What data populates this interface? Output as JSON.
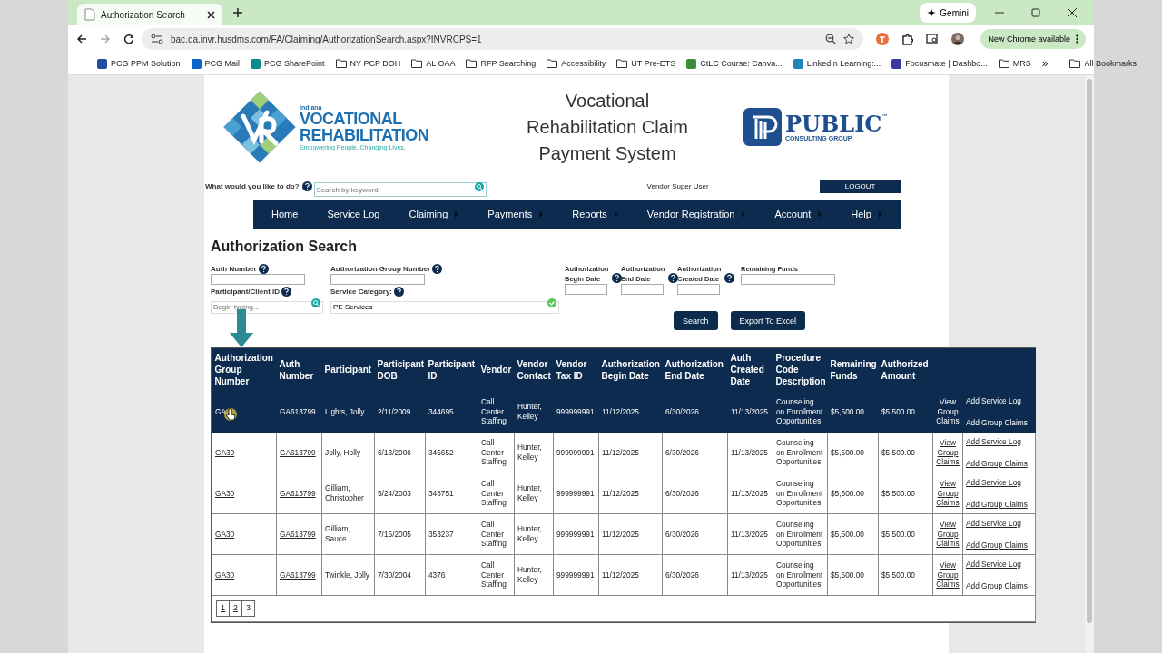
{
  "browser": {
    "tab": {
      "title": "Authorization Search"
    },
    "gemini": "Gemini",
    "url": "bac.qa.invr.husdms.com/FA/Claiming/AuthorizationSearch.aspx?INVRCPS=1",
    "update": "New Chrome available",
    "bookmarks": [
      {
        "label": "PCG PPM Solution",
        "kind": "site",
        "color": "#1f4e9c"
      },
      {
        "label": "PCG Mail",
        "kind": "site",
        "color": "#0a64c8"
      },
      {
        "label": "PCG SharePoint",
        "kind": "site",
        "color": "#0f8a8a"
      },
      {
        "label": "NY PCP DOH",
        "kind": "folder"
      },
      {
        "label": "AL OAA",
        "kind": "folder"
      },
      {
        "label": "RFP Searching",
        "kind": "folder"
      },
      {
        "label": "Accessibility",
        "kind": "folder"
      },
      {
        "label": "UT Pre-ETS",
        "kind": "folder"
      },
      {
        "label": "CtLC Course: Canva...",
        "kind": "site",
        "color": "#3d8c3a"
      },
      {
        "label": "LinkedIn Learning:...",
        "kind": "site",
        "color": "#1b86b8"
      },
      {
        "label": "Focusmate | Dashbo...",
        "kind": "site",
        "color": "#3c3ca0"
      },
      {
        "label": "MRS",
        "kind": "folder"
      }
    ],
    "more": "»",
    "all_bookmarks": "All Bookmarks"
  },
  "header": {
    "logo": {
      "state": "Indiana",
      "line1": "VOCATIONAL",
      "line2": "REHABILITATION",
      "tagline": "Empowering People. Changing Lives."
    },
    "title_lines": [
      "Vocational",
      "Rehabilitation Claim",
      "Payment System"
    ],
    "pcg": {
      "name": "PUBLIC",
      "tm": "™",
      "sub": "CONSULTING GROUP"
    }
  },
  "search": {
    "label": "What would you like to do?",
    "placeholder": "Search by keyword"
  },
  "user": "Vendor Super User",
  "logout": "LOGOUT",
  "nav": [
    {
      "label": "Home",
      "submenu": false
    },
    {
      "label": "Service Log",
      "submenu": false
    },
    {
      "label": "Claiming",
      "submenu": true
    },
    {
      "label": "Payments",
      "submenu": true
    },
    {
      "label": "Reports",
      "submenu": true
    },
    {
      "label": "Vendor Registration",
      "submenu": true
    },
    {
      "label": "Account",
      "submenu": true
    },
    {
      "label": "Help",
      "submenu": true
    }
  ],
  "heading": "Authorization Search",
  "left_fields": [
    {
      "label": "Auth Number",
      "help": true,
      "kind": "text"
    },
    {
      "label": "Authorization Group Number",
      "help": true,
      "kind": "text"
    },
    {
      "label": "Participant/Client ID",
      "help": true,
      "kind": "lookup",
      "placeholder": "Begin typing..."
    },
    {
      "label": "Service Category:",
      "help": true,
      "kind": "select",
      "value": "PE Services"
    }
  ],
  "date_fields": [
    {
      "label": "Authorization Begin Date",
      "help": true
    },
    {
      "label": "Authorization End Date",
      "help": true
    },
    {
      "label": "Authorization Created Date",
      "help": true
    },
    {
      "label": "Remaining Funds",
      "help": false
    }
  ],
  "buttons": [
    "Search",
    "Export To Excel"
  ],
  "table": {
    "columns": [
      "Authorization Group Number",
      "Auth Number",
      "Participant",
      "Participant DOB",
      "Participant ID",
      "Vendor",
      "Vendor Contact",
      "Vendor Tax ID",
      "Authorization Begin Date",
      "Authorization End Date",
      "Auth Created Date",
      "Procedure Code Description",
      "Remaining Funds",
      "Authorized Amount"
    ],
    "rows": [
      {
        "selected": true,
        "cells": [
          "GA",
          "GA613799",
          "Lights, Jolly",
          "2/11/2009",
          "344695",
          "Call Center Staffing",
          "Hunter, Kelley",
          "999999991",
          "11/12/2025",
          "6/30/2026",
          "11/13/2025",
          "Counseling on Enrollment Opportunities",
          "$5,500.00",
          "$5,500.00"
        ],
        "view": "View Group Claims",
        "service_log": "Add Service Log",
        "group_claims": "Add Group Claims"
      },
      {
        "selected": false,
        "cells": [
          "GA30",
          "GA613799",
          "Jolly, Holly",
          "6/13/2006",
          "345652",
          "Call Center Staffing",
          "Hunter, Kelley",
          "999999991",
          "11/12/2025",
          "6/30/2026",
          "11/13/2025",
          "Counseling on Enrollment Opportunities",
          "$5,500.00",
          "$5,500.00"
        ],
        "view": "View Group Claims",
        "service_log": "Add Service Log",
        "group_claims": "Add Group Claims"
      },
      {
        "selected": false,
        "cells": [
          "GA30",
          "GA613799",
          "Gilliam, Christopher",
          "5/24/2003",
          "348751",
          "Call Center Staffing",
          "Hunter, Kelley",
          "999999991",
          "11/12/2025",
          "6/30/2026",
          "11/13/2025",
          "Counseling on Enrollment Opportunities",
          "$5,500.00",
          "$5,500.00"
        ],
        "view": "View Group Claims",
        "service_log": "Add Service Log",
        "group_claims": "Add Group Claims"
      },
      {
        "selected": false,
        "cells": [
          "GA30",
          "GA613799",
          "Gilliam, Sauce",
          "7/15/2005",
          "353237",
          "Call Center Staffing",
          "Hunter, Kelley",
          "999999991",
          "11/12/2025",
          "6/30/2026",
          "11/13/2025",
          "Counseling on Enrollment Opportunities",
          "$5,500.00",
          "$5,500.00"
        ],
        "view": "View Group Claims",
        "service_log": "Add Service Log",
        "group_claims": "Add Group Claims"
      },
      {
        "selected": false,
        "cells": [
          "GA30",
          "GA613799",
          "Twinkle, Jolly",
          "7/30/2004",
          "4376",
          "Call Center Staffing",
          "Hunter, Kelley",
          "999999991",
          "11/12/2025",
          "6/30/2026",
          "11/13/2025",
          "Counseling on Enrollment Opportunities",
          "$5,500.00",
          "$5,500.00"
        ],
        "view": "View Group Claims",
        "service_log": "Add Service Log",
        "group_claims": "Add Group Claims"
      }
    ],
    "pages": [
      {
        "label": "1",
        "selected": false
      },
      {
        "label": "2",
        "selected": false
      },
      {
        "label": "3",
        "selected": true
      }
    ]
  }
}
